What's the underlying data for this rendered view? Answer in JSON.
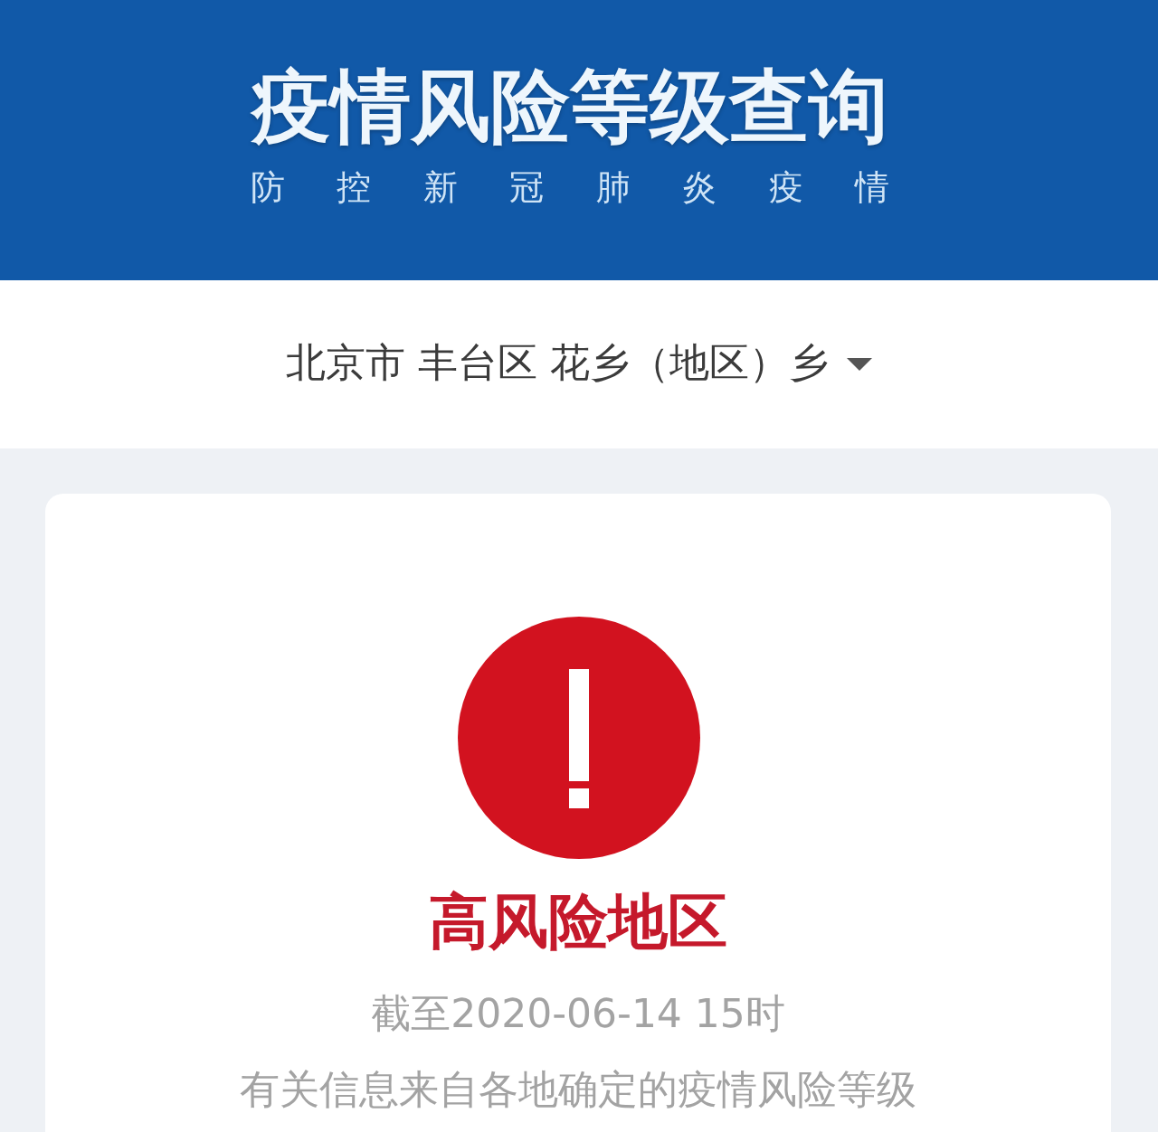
{
  "header": {
    "title": "疫情风险等级查询",
    "subtitle": "防控新冠肺炎疫情"
  },
  "location": {
    "value": "北京市 丰台区 花乡（地区）乡"
  },
  "result": {
    "kind": "high",
    "label": "高风险地区",
    "as_of": "截至2020-06-14 15时",
    "note": "有关信息来自各地确定的疫情风险等级"
  }
}
